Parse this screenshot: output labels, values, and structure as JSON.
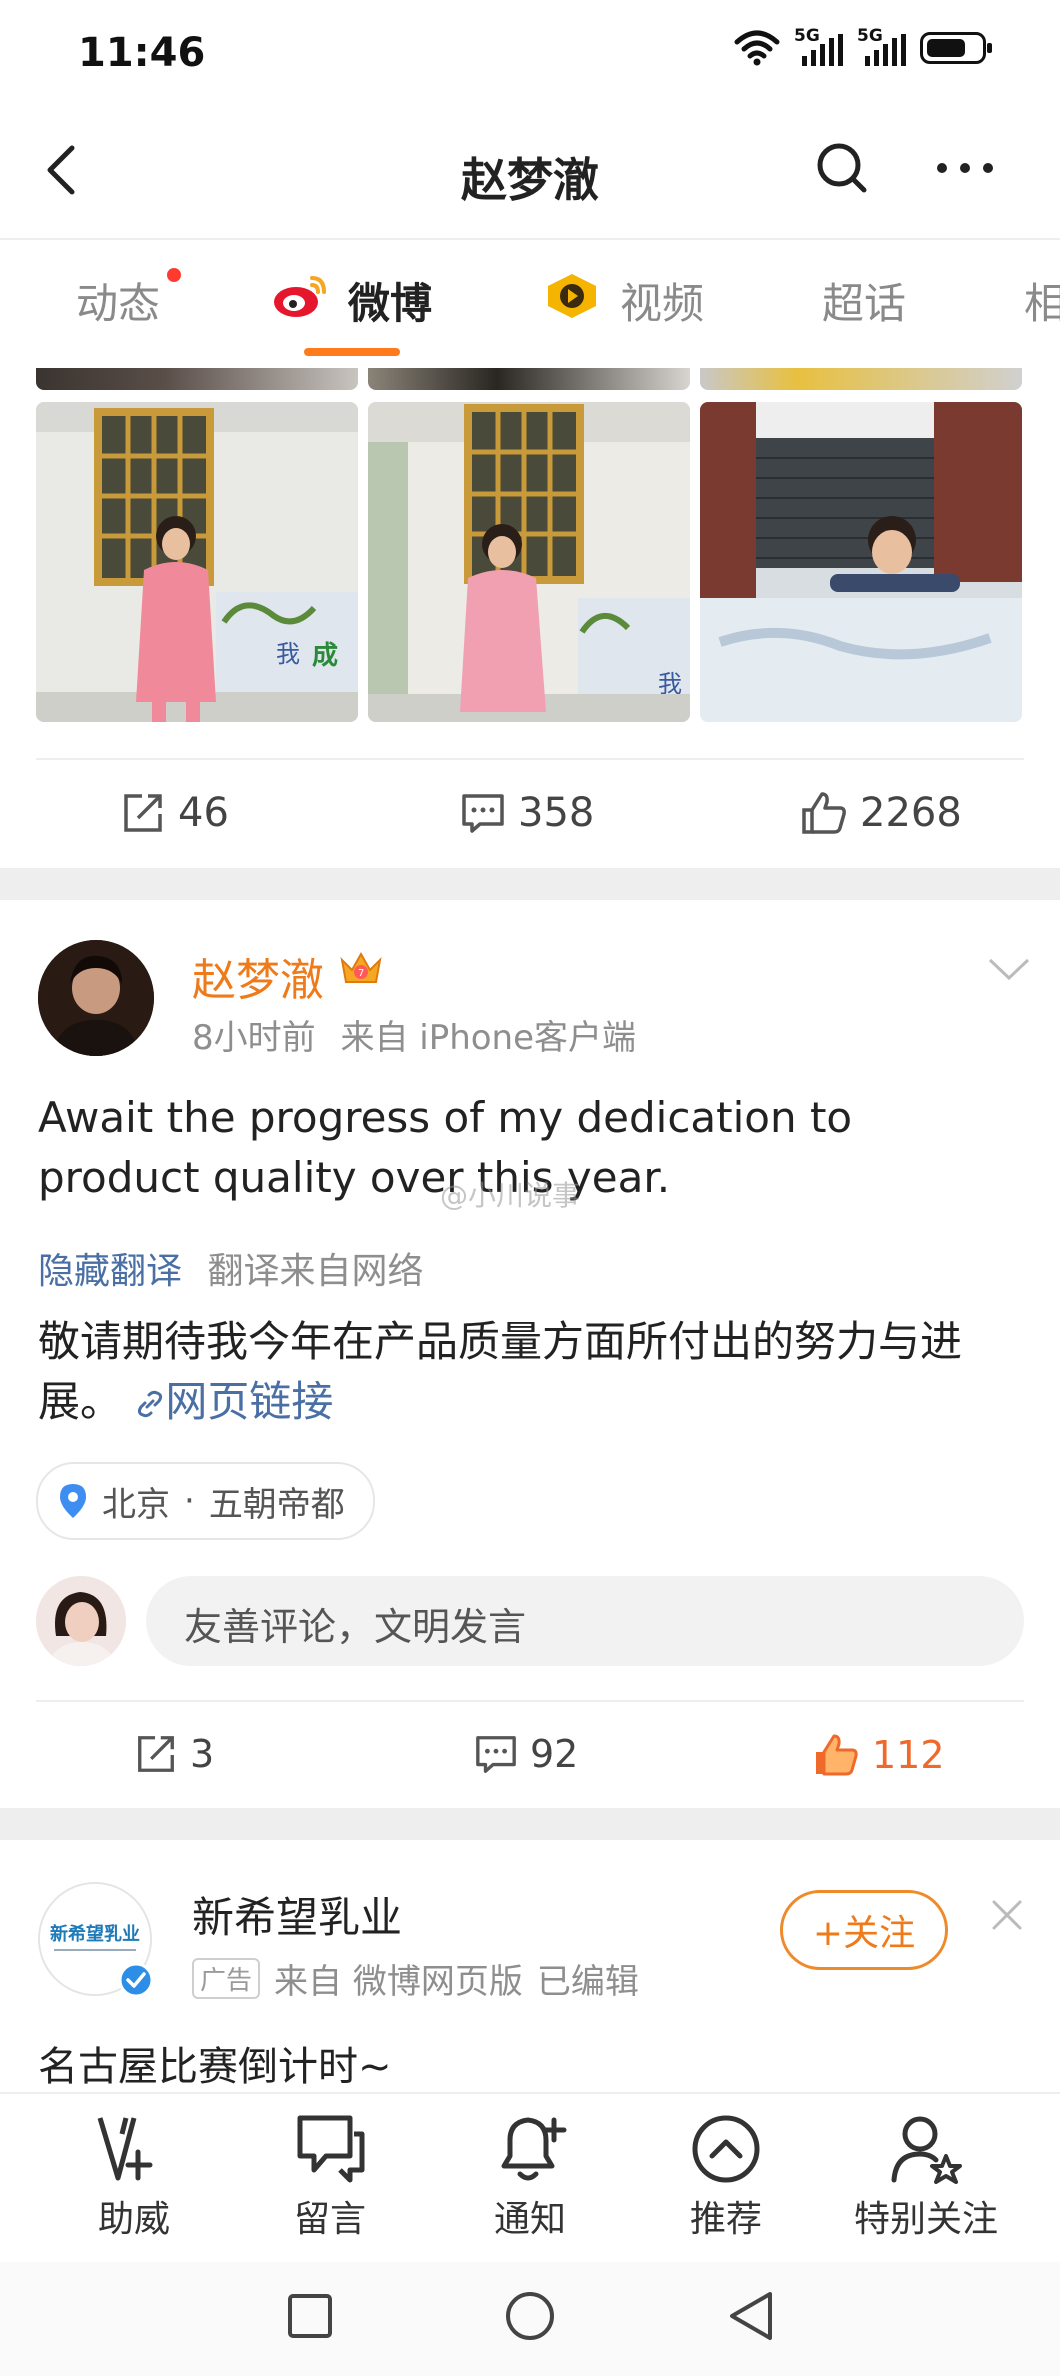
{
  "status_bar": {
    "time": "11:46",
    "network_1": "5G",
    "network_2": "5G"
  },
  "header": {
    "title": "赵梦澈"
  },
  "tabs": [
    {
      "label": "动态"
    },
    {
      "label": "微博"
    },
    {
      "label": "视频"
    },
    {
      "label": "超话"
    },
    {
      "label": "相"
    }
  ],
  "post_1": {
    "reposts": "46",
    "comments": "358",
    "likes": "2268"
  },
  "post_2": {
    "author": "赵梦澈",
    "time": "8小时前",
    "source": "来自 iPhone客户端",
    "text_en": "Await the progress of my dedication to product quality over this year.",
    "watermark": "@小川说事",
    "hide_translation": "隐藏翻译",
    "translation_source": "翻译来自网络",
    "text_zh": "敬请期待我今年在产品质量方面所付出的努力与进展。",
    "link_label": "网页链接",
    "location": "北京",
    "location_sub": "五朝帝都",
    "comment_placeholder": "友善评论，文明发言",
    "reposts": "3",
    "comments": "92",
    "likes": "112"
  },
  "ad_post": {
    "name": "新希望乳业",
    "avatar_text": "新希望乳业",
    "ad_label": "广告",
    "source": "来自 微博网页版",
    "edited": "已编辑",
    "follow_label": "+关注",
    "text": "名古屋比赛倒计时~"
  },
  "bottom_bar": [
    {
      "label": "助威",
      "icon": "cheer-icon"
    },
    {
      "label": "留言",
      "icon": "message-icon"
    },
    {
      "label": "通知",
      "icon": "bell-plus-icon"
    },
    {
      "label": "推荐",
      "icon": "chevron-up-circle-icon"
    },
    {
      "label": "特别关注",
      "icon": "user-star-icon"
    }
  ],
  "colors": {
    "accent": "#ef7a1a",
    "link": "#4a6fa5",
    "like_active": "#ef6a2a"
  }
}
